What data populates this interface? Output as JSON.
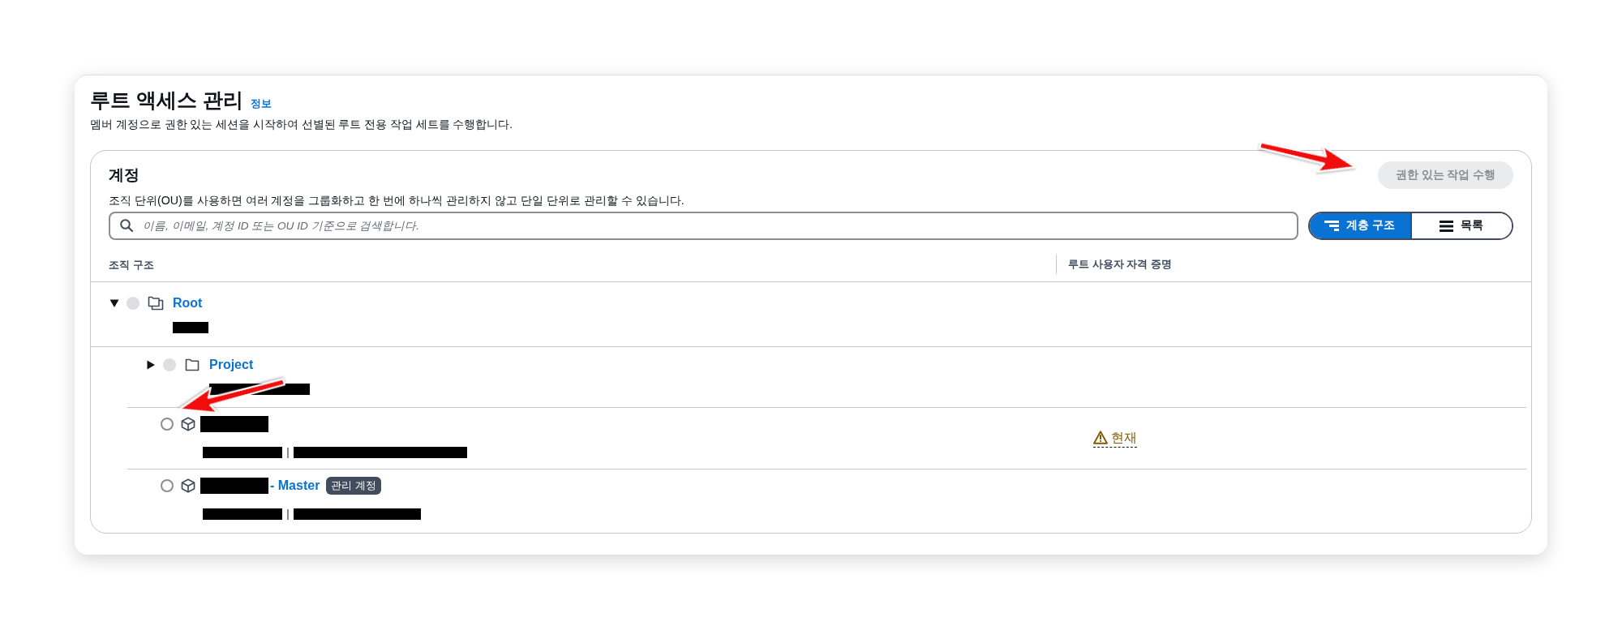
{
  "page": {
    "title": "루트 액세스 관리",
    "info_link": "정보",
    "description": "멤버 계정으로 권한 있는 세션을 시작하여 선별된 루트 전용 작업 세트를 수행합니다."
  },
  "accounts_panel": {
    "title": "계정",
    "action_button": {
      "label": "권한 있는 작업 수행",
      "disabled": true
    },
    "description": "조직 단위(OU)를 사용하면 여러 계정을 그룹화하고 한 번에 하나씩 관리하지 않고 단일 단위로 관리할 수 있습니다.",
    "search": {
      "placeholder": "이름, 이메일, 계정 ID 또는 OU ID 기준으로 검색합니다."
    },
    "view_toggle": [
      {
        "kind": "hierarchy",
        "label": "계층 구조",
        "selected": true
      },
      {
        "kind": "list",
        "label": "목록",
        "selected": false
      }
    ],
    "table": {
      "columns": [
        "조직 구조",
        "루트 사용자 자격 증명"
      ],
      "tree": [
        {
          "kind": "root",
          "name_parts": [
            {
              "kind": "link",
              "text": "Root"
            }
          ],
          "details": [
            {
              "kind": "redacted"
            }
          ],
          "expanded": true,
          "selected": false,
          "disabled": true,
          "children": [
            {
              "kind": "ou",
              "name_parts": [
                {
                  "kind": "link",
                  "text": "Project"
                }
              ],
              "details": [
                {
                  "kind": "redacted"
                }
              ],
              "expanded": false,
              "selected": false,
              "disabled": true
            },
            {
              "kind": "account",
              "name_parts": [
                {
                  "kind": "redacted"
                }
              ],
              "details": [
                {
                  "kind": "redacted"
                },
                {
                  "kind": "redacted"
                }
              ],
              "selected": false,
              "disabled": false,
              "credential": {
                "kind": "warning",
                "text": "현재"
              }
            },
            {
              "kind": "account",
              "name_parts": [
                {
                  "kind": "redacted"
                },
                {
                  "kind": "link",
                  "text": "- Master"
                }
              ],
              "badge": "관리 계정",
              "details": [
                {
                  "kind": "redacted"
                },
                {
                  "kind": "redacted"
                }
              ],
              "selected": false,
              "disabled": false
            }
          ]
        }
      ]
    }
  }
}
